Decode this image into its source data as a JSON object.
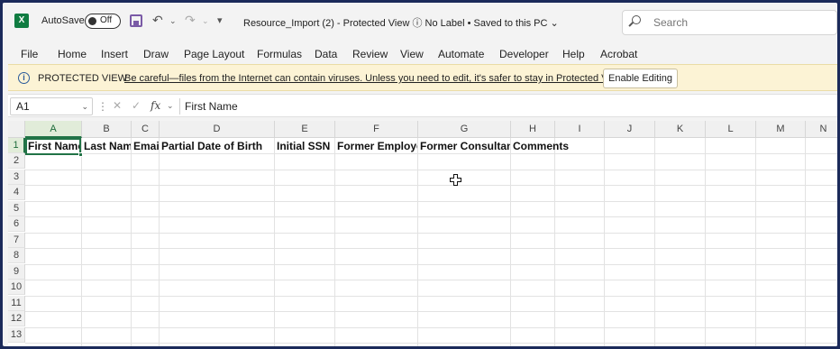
{
  "titlebar": {
    "app_icon": "excel-logo-icon",
    "app_icon_text": "X",
    "autosave_label": "AutoSave",
    "autosave_state": "Off",
    "doc_title": "Resource_Import (2)  -  Protected View  ⓘ No Label  •  Saved to this PC ⌄",
    "search_placeholder": "Search"
  },
  "menu": {
    "items": [
      "File",
      "Home",
      "Insert",
      "Draw",
      "Page Layout",
      "Formulas",
      "Data",
      "Review",
      "View",
      "Automate",
      "Developer",
      "Help",
      "Acrobat"
    ]
  },
  "protected_view": {
    "title": "PROTECTED VIEW",
    "message": "Be careful—files from the Internet can contain viruses. Unless you need to edit, it's safer to stay in Protected View.",
    "button": "Enable Editing"
  },
  "formula_bar": {
    "name_box": "A1",
    "fx": "fx",
    "value": "First Name"
  },
  "sheet": {
    "columns": [
      "A",
      "B",
      "C",
      "D",
      "E",
      "F",
      "G",
      "H",
      "I",
      "J",
      "K",
      "L",
      "M",
      "N"
    ],
    "rows": [
      "1",
      "2",
      "3",
      "4",
      "5",
      "6",
      "7",
      "8",
      "9",
      "10",
      "11",
      "12",
      "13"
    ],
    "headers": [
      "First Name",
      "Last Name",
      "Email",
      "Partial Date of Birth",
      "Initial SSN",
      "Former Employee",
      "Former Consultant",
      "Comments"
    ],
    "selected_cell": "A1"
  },
  "colors": {
    "accent": "#217346",
    "pv_background": "#fcf3d5"
  }
}
